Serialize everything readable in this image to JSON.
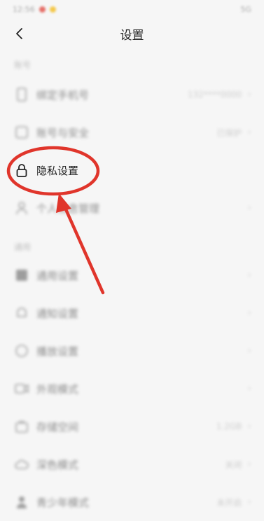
{
  "status_bar": {
    "time": "12:56",
    "right": "5G"
  },
  "header": {
    "title": "设置"
  },
  "sections": [
    {
      "label": "账号"
    },
    {
      "label": "通用"
    }
  ],
  "rows": [
    {
      "label": "绑定手机号",
      "value": "132****0000",
      "icon": "phone-icon"
    },
    {
      "label": "账号与安全",
      "value": "已保护",
      "icon": "shield-icon"
    },
    {
      "label": "隐私设置",
      "value": "",
      "icon": "lock-icon"
    },
    {
      "label": "个人信息管理",
      "value": "",
      "icon": "person-icon"
    },
    {
      "label": "通用设置",
      "value": "",
      "icon": "grid-icon"
    },
    {
      "label": "通知设置",
      "value": "",
      "icon": "bell-icon"
    },
    {
      "label": "播放设置",
      "value": "",
      "icon": "play-icon"
    },
    {
      "label": "外观模式",
      "value": "",
      "icon": "video-icon"
    },
    {
      "label": "存储空间",
      "value": "1.2GB",
      "icon": "box-icon"
    },
    {
      "label": "深色模式",
      "value": "关闭",
      "icon": "cloud-icon"
    },
    {
      "label": "青少年模式",
      "value": "未开启",
      "icon": "shield-person-icon"
    }
  ],
  "colors": {
    "accent": "#e0352b"
  }
}
